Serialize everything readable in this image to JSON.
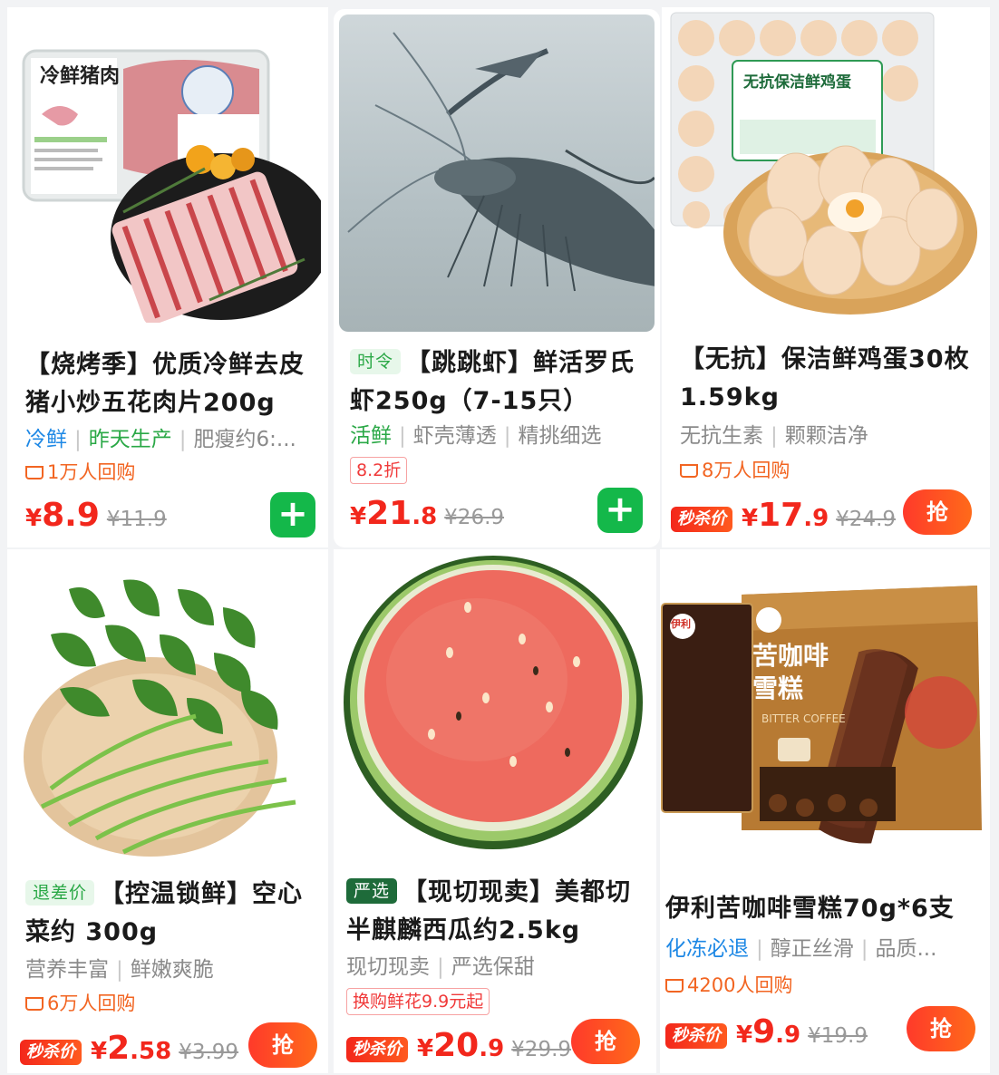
{
  "products": [
    {
      "title": "【烧烤季】优质冷鲜去皮猪小炒五花肉片200g",
      "tag": "",
      "features": [
        "冷鲜",
        "昨天生产",
        "肥瘦约6:..."
      ],
      "rebuy": "1万人回购",
      "coupon": "",
      "badge": "",
      "price_yen": "¥",
      "price_int": "8.9",
      "price_dec": "",
      "old_price": "¥11.9",
      "button": "+",
      "package_text": "冷鲜猪肉"
    },
    {
      "title": "【跳跳虾】鲜活罗氏虾250g（7-15只）",
      "tag": "时令",
      "features": [
        "活鲜",
        "虾壳薄透",
        "精挑细选"
      ],
      "rebuy": "",
      "coupon": "8.2折",
      "badge": "",
      "price_yen": "¥",
      "price_int": "21",
      "price_dec": ".8",
      "old_price": "¥26.9",
      "button": "+"
    },
    {
      "title": "【无抗】保洁鲜鸡蛋30枚1.59kg",
      "tag": "",
      "features": [
        "无抗生素",
        "颗颗洁净"
      ],
      "rebuy": "8万人回购",
      "coupon": "",
      "badge": "秒杀价",
      "price_yen": "¥",
      "price_int": "17",
      "price_dec": ".9",
      "old_price": "¥24.9",
      "button": "抢",
      "package_text": "无抗保洁鲜鸡蛋"
    },
    {
      "title": "【控温锁鲜】空心菜约 300g",
      "tag": "退差价",
      "features": [
        "营养丰富",
        "鲜嫩爽脆"
      ],
      "rebuy": "6万人回购",
      "coupon": "",
      "badge": "秒杀价",
      "price_yen": "¥",
      "price_int": "2",
      "price_dec": ".58",
      "old_price": "¥3.99",
      "button": "抢"
    },
    {
      "title": "【现切现卖】美都切半麒麟西瓜约2.5kg",
      "tag": "严选",
      "features": [
        "现切现卖",
        "严选保甜"
      ],
      "rebuy": "",
      "coupon": "换购鲜花9.9元起",
      "badge": "秒杀价",
      "price_yen": "¥",
      "price_int": "20",
      "price_dec": ".9",
      "old_price": "¥29.9",
      "button": "抢"
    },
    {
      "title": "伊利苦咖啡雪糕70g*6支",
      "tag": "",
      "features": [
        "化冻必退",
        "醇正丝滑",
        "品质..."
      ],
      "rebuy": "4200人回购",
      "coupon": "",
      "badge": "秒杀价",
      "price_yen": "¥",
      "price_int": "9",
      "price_dec": ".9",
      "old_price": "¥19.9",
      "button": "抢",
      "package_text": "苦咖啡雪糕",
      "package_sub": "BITTER COFFEE",
      "brand": "伊利"
    }
  ]
}
